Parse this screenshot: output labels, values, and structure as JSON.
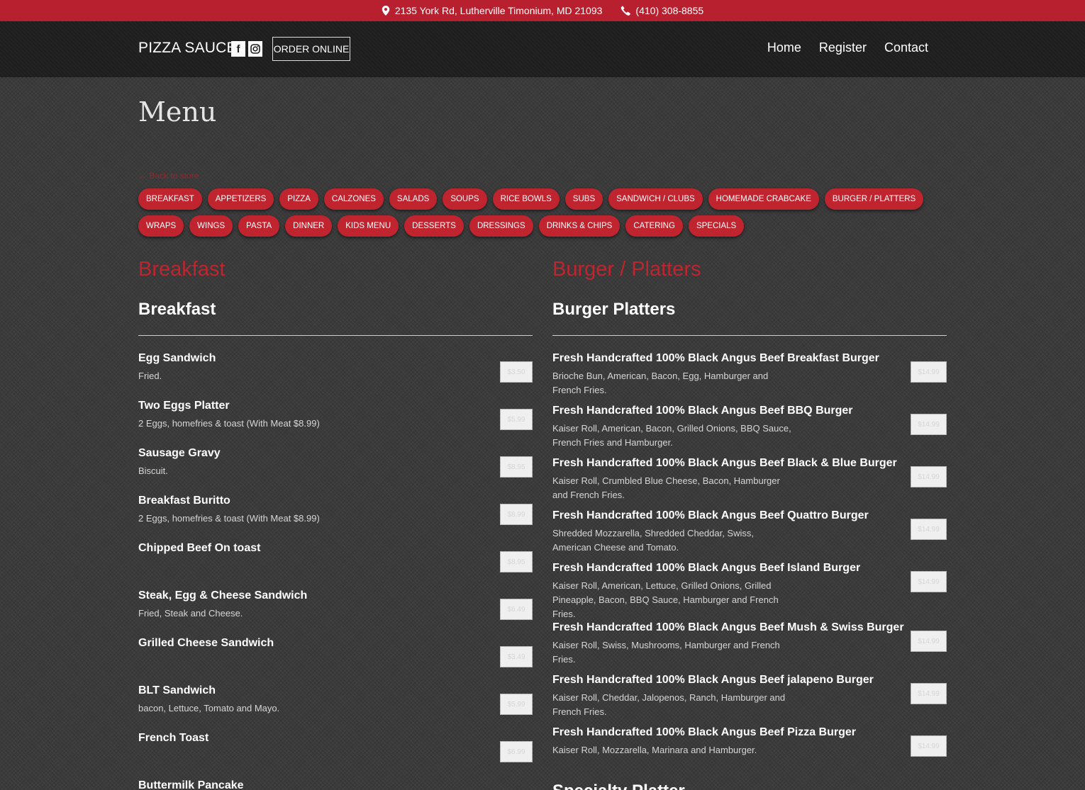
{
  "topbar": {
    "address": "2135 York Rd, Lutherville Timonium, MD 21093",
    "phone": "(410) 308-8855"
  },
  "header": {
    "brand": "PIZZA SAUCE",
    "order_online": "ORDER ONLINE",
    "nav": [
      "Home",
      "Register",
      "Contact"
    ]
  },
  "page": {
    "title": "Menu",
    "back_link": "← Back to store"
  },
  "categories": [
    "BREAKFAST",
    "APPETIZERS",
    "PIZZA",
    "CALZONES",
    "SALADS",
    "SOUPS",
    "RICE BOWLS",
    "SUBS",
    "SANDWICH / CLUBS",
    "HOMEMADE CRABCAKE",
    "BURGER / PLATTERS",
    "WRAPS",
    "WINGS",
    "PASTA",
    "DINNER",
    "KIDS MENU",
    "DESSERTS",
    "DRESSINGS",
    "DRINKS & CHIPS",
    "CATERING",
    "SPECIALS"
  ],
  "left_section": {
    "title": "Breakfast",
    "subtitle": "Breakfast",
    "items": [
      {
        "name": "Egg Sandwich",
        "desc": "Fried.",
        "price": "$3.50"
      },
      {
        "name": "Two Eggs Platter",
        "desc": "2 Eggs, homefries & toast (With Meat $8.99)",
        "price": "$5.99"
      },
      {
        "name": "Sausage Gravy",
        "desc": "Biscuit.",
        "price": "$8.95"
      },
      {
        "name": "Breakfast Buritto",
        "desc": "2 Eggs, homefries & toast (With Meat $8.99)",
        "price": "$8.99"
      },
      {
        "name": "Chipped Beef On toast",
        "desc": "",
        "price": "$8.95"
      },
      {
        "name": "Steak, Egg & Cheese Sandwich",
        "desc": "Fried, Steak and Cheese.",
        "price": "$6.49"
      },
      {
        "name": "Grilled Cheese Sandwich",
        "desc": "",
        "price": "$3.49"
      },
      {
        "name": "BLT Sandwich",
        "desc": "bacon, Lettuce, Tomato and Mayo.",
        "price": "$5.99"
      },
      {
        "name": "French Toast",
        "desc": "",
        "price": "$6.99"
      },
      {
        "name": "Buttermilk Pancake",
        "desc": "",
        "price": ""
      }
    ]
  },
  "right_section": {
    "title": "Burger / Platters",
    "subtitle": "Burger Platters",
    "items": [
      {
        "name": "Fresh Handcrafted 100% Black Angus Beef Breakfast Burger",
        "desc": "Brioche Bun, American, Bacon, Egg, Hamburger and French Fries.",
        "price": "$14.99"
      },
      {
        "name": "Fresh Handcrafted 100% Black Angus Beef BBQ Burger",
        "desc": "Kaiser Roll, American, Bacon, Grilled Onions, BBQ Sauce, French Fries and Hamburger.",
        "price": "$14.99"
      },
      {
        "name": "Fresh Handcrafted 100% Black Angus Beef Black & Blue Burger",
        "desc": "Kaiser Roll, Crumbled Blue Cheese, Bacon, Hamburger and French Fries.",
        "price": "$14.99"
      },
      {
        "name": "Fresh Handcrafted 100% Black Angus Beef Quattro Burger",
        "desc": "Shredded Mozzarella, Shredded Cheddar, Swiss, American Cheese and Tomato.",
        "price": "$14.99"
      },
      {
        "name": "Fresh Handcrafted 100% Black Angus Beef Island Burger",
        "desc": "Kaiser Roll, American, Lettuce, Grilled Onions, Grilled Pineapple, Bacon, BBQ Sauce, Hamburger and French Fries.",
        "price": "$14.99"
      },
      {
        "name": "Fresh Handcrafted 100% Black Angus Beef Mush & Swiss Burger",
        "desc": "Kaiser Roll, Swiss, Mushrooms, Hamburger and French Fries.",
        "price": "$14.99"
      },
      {
        "name": "Fresh Handcrafted 100% Black Angus Beef jalapeno Burger",
        "desc": "Kaiser Roll, Cheddar, Jalopenos, Ranch, Hamburger and French Fries.",
        "price": "$14.99"
      },
      {
        "name": "Fresh Handcrafted 100% Black Angus Beef Pizza Burger",
        "desc": "Kaiser Roll, Mozzarella, Marinara and Hamburger.",
        "price": "$14.99"
      }
    ],
    "next_subtitle": "Specialty Platter"
  },
  "colors": {
    "accent": "#c0242f",
    "topbar": "#b8202f",
    "navbar": "#1e1e1e"
  }
}
